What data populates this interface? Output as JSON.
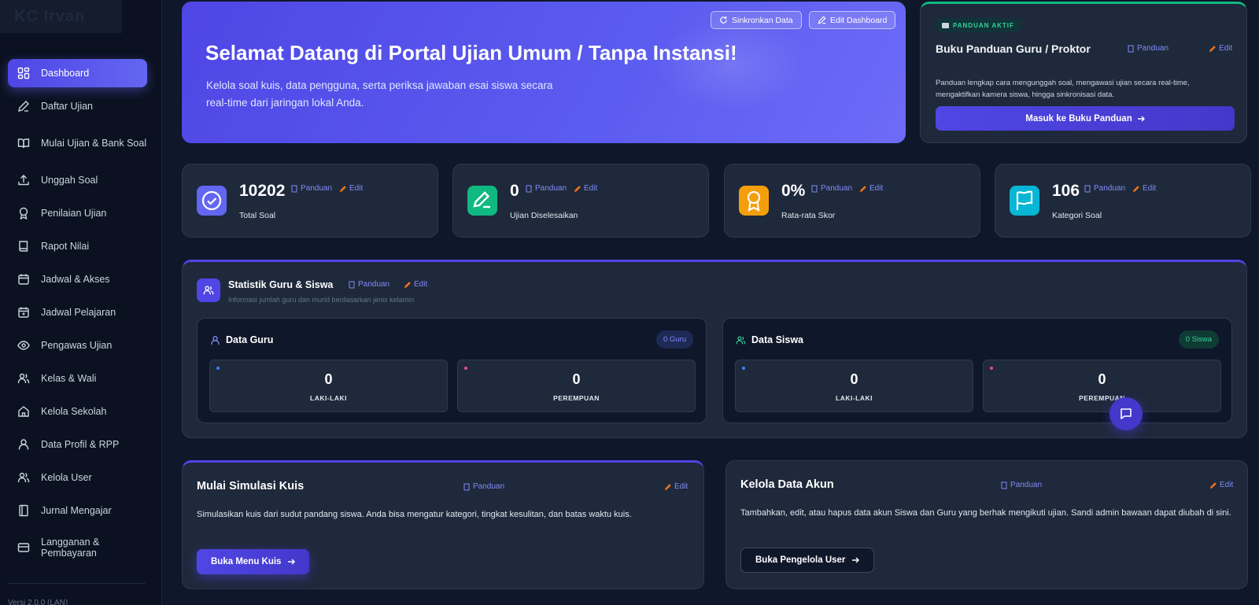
{
  "brand": {
    "name": "KC Irvan"
  },
  "sidebar": {
    "items": [
      {
        "label": "Dashboard",
        "icon": "dashboard-icon"
      },
      {
        "label": "Daftar Ujian",
        "icon": "pencil-icon"
      },
      {
        "label": "Mulai Ujian & Bank Soal",
        "icon": "book-open-icon"
      },
      {
        "label": "Unggah Soal",
        "icon": "upload-icon"
      },
      {
        "label": "Penilaian Ujian",
        "icon": "award-icon"
      },
      {
        "label": "Rapot Nilai",
        "icon": "book-icon"
      },
      {
        "label": "Jadwal & Akses",
        "icon": "calendar-icon"
      },
      {
        "label": "Jadwal Pelajaran",
        "icon": "calendar-check-icon"
      },
      {
        "label": "Pengawas Ujian",
        "icon": "eye-icon"
      },
      {
        "label": "Kelas & Wali",
        "icon": "users-icon"
      },
      {
        "label": "Kelola Sekolah",
        "icon": "home-icon"
      },
      {
        "label": "Data Profil & RPP",
        "icon": "user-icon"
      },
      {
        "label": "Kelola User",
        "icon": "users-icon"
      },
      {
        "label": "Jurnal Mengajar",
        "icon": "notebook-icon"
      },
      {
        "label": "Langganan & Pembayaran",
        "icon": "credit-card-icon"
      }
    ],
    "version": "Versi 2.0.0 (LAN)"
  },
  "hero": {
    "title": "Selamat Datang di Portal Ujian Umum / Tanpa Instansi!",
    "description": "Kelola soal kuis, data pengguna, serta periksa jawaban esai siswa secara real-time dari jaringan lokal Anda.",
    "sync_label": "Sinkronkan Data",
    "edit_label": "Edit Dashboard"
  },
  "guide": {
    "badge": "PANDUAN AKTIF",
    "title": "Buku Panduan Guru / Proktor",
    "panduan": "Panduan",
    "edit": "Edit",
    "description": "Panduan lengkap cara mengunggah soal, mengawasi ujian secara real-time, mengaktifkan kamera siswa, hingga sinkronisasi data.",
    "cta": "Masuk ke Buku Panduan"
  },
  "links": {
    "panduan": "Panduan",
    "edit": "Edit"
  },
  "stats": [
    {
      "value": "10202",
      "label": "Total Soal",
      "icon": "check-circle-icon",
      "color": "#6366f1"
    },
    {
      "value": "0",
      "label": "Ujian Diselesaikan",
      "icon": "pencil-square-icon",
      "color": "#10b981"
    },
    {
      "value": "0%",
      "label": "Rata-rata Skor",
      "icon": "medal-icon",
      "color": "#f59e0b"
    },
    {
      "value": "106",
      "label": "Kategori Soal",
      "icon": "flag-icon",
      "color": "#06b6d4"
    }
  ],
  "statistik": {
    "title": "Statistik Guru & Siswa",
    "subtitle": "Informasi jumlah guru dan murid berdasarkan jenis kelamin",
    "guru": {
      "title": "Data Guru",
      "badge": "0 Guru",
      "male": "0",
      "female": "0",
      "male_label": "LAKI-LAKI",
      "female_label": "PEREMPUAN"
    },
    "siswa": {
      "title": "Data Siswa",
      "badge": "0 Siswa",
      "male": "0",
      "female": "0",
      "male_label": "LAKI-LAKI",
      "female_label": "PEREMPUAN"
    }
  },
  "simulasi": {
    "title": "Mulai Simulasi Kuis",
    "description": "Simulasikan kuis dari sudut pandang siswa. Anda bisa mengatur kategori, tingkat kesulitan, dan batas waktu kuis.",
    "button": "Buka Menu Kuis"
  },
  "akun": {
    "title": "Kelola Data Akun",
    "description": "Tambahkan, edit, atau hapus data akun Siswa dan Guru yang berhak mengikuti ujian. Sandi admin bawaan dapat diubah di sini.",
    "button": "Buka Pengelola User"
  },
  "colors": {
    "accent": "#4f46e5",
    "success": "#10b981",
    "pink": "#ec4899",
    "blue": "#3b82f6"
  }
}
